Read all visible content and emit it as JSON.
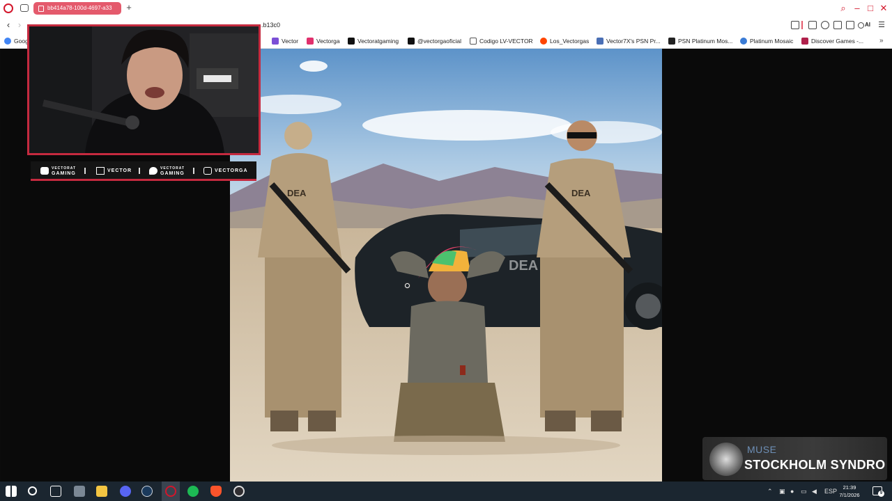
{
  "browser": {
    "tab_title": "bb414a78-100d-4697-a33",
    "url_fragment": "...b13c0",
    "ai_label": "AI"
  },
  "bookmarks": [
    {
      "label": "Goog",
      "icon": "google-icon",
      "color": "#4285f4"
    },
    {
      "label": "Vector",
      "icon": "heart-icon",
      "color": "#7b4fd6"
    },
    {
      "label": "Vectorga",
      "icon": "instagram-icon",
      "color": "#e1306c"
    },
    {
      "label": "Vectoratgaming",
      "icon": "x-icon",
      "color": "#111111"
    },
    {
      "label": "@vectorgaoficial",
      "icon": "tiktok-icon",
      "color": "#111111"
    },
    {
      "label": "Codigo LV-VECTOR",
      "icon": "bookmark-icon",
      "color": "#555555"
    },
    {
      "label": "Los_Vectorgas",
      "icon": "reddit-icon",
      "color": "#ff4500"
    },
    {
      "label": "Vector7X's PSN Pr...",
      "icon": "psn-icon",
      "color": "#4a6fb5"
    },
    {
      "label": "PSN Platinum Mos...",
      "icon": "psn-icon",
      "color": "#222222"
    },
    {
      "label": "Platinum Mosaic",
      "icon": "diamond-icon",
      "color": "#3a7bd5"
    },
    {
      "label": "Discover Games -...",
      "icon": "games-icon",
      "color": "#b0204b"
    }
  ],
  "stream_overlay": {
    "social_links": [
      {
        "top": "VECTORAT",
        "bottom": "GAMING",
        "icon": "youtube-icon"
      },
      {
        "top": "VECTOR",
        "bottom": "",
        "icon": "twitch-icon"
      },
      {
        "top": "VECTORAT",
        "bottom": "GAMING",
        "icon": "twitter-icon"
      },
      {
        "top": "VECTORGA",
        "bottom": "",
        "icon": "instagram-icon"
      }
    ],
    "now_playing": {
      "artist": "MUSE",
      "title": "STOCKHOLM SYNDRO"
    },
    "accent_color": "#c52a3f"
  },
  "taskbar": {
    "apps": [
      "start-icon",
      "search-icon",
      "task-view-icon",
      "file-app-icon",
      "folder-icon",
      "discord-icon",
      "steam-icon",
      "opera-icon",
      "spotify-icon",
      "brave-icon",
      "obs-icon"
    ],
    "language": "ESP",
    "time": "21:39",
    "date": "7/1/2026",
    "notification_count": "9"
  }
}
